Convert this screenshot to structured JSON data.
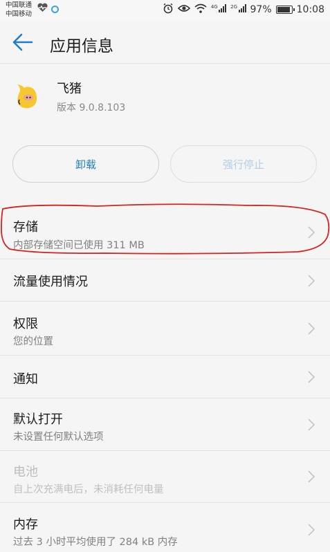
{
  "status_bar": {
    "carrier1": "中国联通",
    "carrier2": "中国移动",
    "battery_percent": "97%",
    "battery_level": 0.97,
    "time": "10:08",
    "net1": "4G",
    "net2": "2G",
    "icons": [
      "heart-monitor-icon",
      "ring-icon",
      "alarm-icon",
      "eye-icon",
      "wifi-icon",
      "signal-icon",
      "battery-icon"
    ]
  },
  "header": {
    "title": "应用信息"
  },
  "app": {
    "name": "飞猪",
    "version": "版本 9.0.8.103"
  },
  "actions": {
    "uninstall": "卸载",
    "force_stop": "强行停止"
  },
  "rows": [
    {
      "title": "存储",
      "subtitle": "内部存储空间已使用 311 MB",
      "enabled": true
    },
    {
      "title": "流量使用情况",
      "subtitle": "",
      "enabled": true
    },
    {
      "title": "权限",
      "subtitle": "您的位置",
      "enabled": true
    },
    {
      "title": "通知",
      "subtitle": "",
      "enabled": true
    },
    {
      "title": "默认打开",
      "subtitle": "未设置任何默认选项",
      "enabled": true
    },
    {
      "title": "电池",
      "subtitle": "自上次充满电后，未消耗任何电量",
      "enabled": false
    },
    {
      "title": "内存",
      "subtitle": "过去 3 小时平均使用了 284 kB 内存",
      "enabled": true
    }
  ],
  "colors": {
    "accent": "#1e7fc9",
    "highlight_annotation": "#d6221c",
    "app_icon_yellow": "#f7c82e"
  }
}
